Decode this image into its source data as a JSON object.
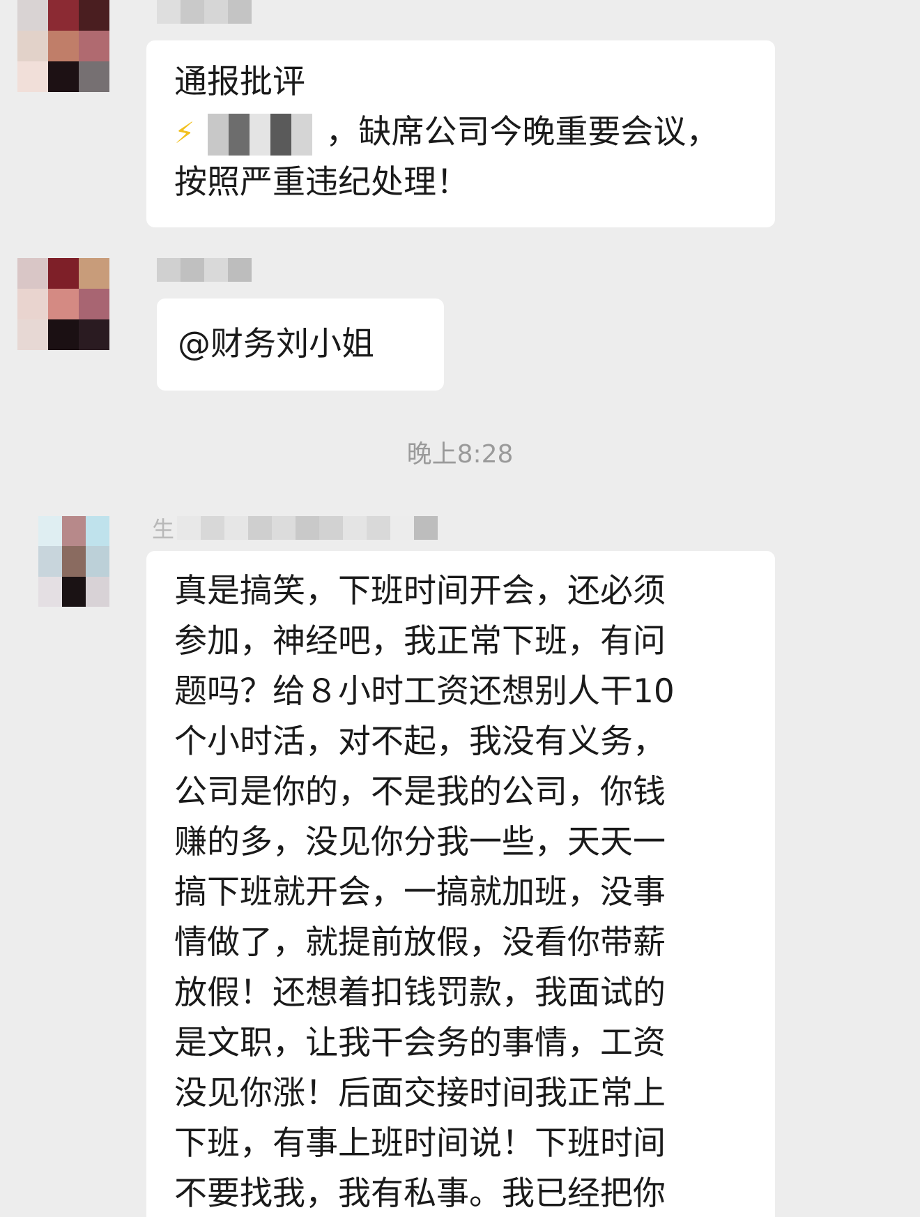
{
  "messages": [
    {
      "line1": "通报批评",
      "bolt": "⚡",
      "line2_suffix": "，缺席公司今晚重要会议，",
      "line3": "按照严重违纪处理！"
    },
    {
      "text": "@财务刘小姐"
    },
    {
      "sender_partial": "生",
      "lines": [
        "真是搞笑，下班时间开会，还必须",
        "参加，神经吧，我正常下班，有问",
        "题吗？给８小时工资还想别人干10",
        "个小时活，对不起，我没有义务，",
        "公司是你的，不是我的公司，你钱",
        "赚的多，没见你分我一些，天天一",
        "搞下班就开会，一搞就加班，没事",
        "情做了，就提前放假，没看你带薪",
        "放假！还想着扣钱罚款，我面试的",
        "是文职，让我干会务的事情，工资",
        "没见你涨！后面交接时间我正常上",
        "下班，有事上班时间说！下班时间",
        "不要找我，我有私事。我已经把你"
      ]
    }
  ],
  "timestamp": "晚上8:28",
  "colors": {
    "background": "#ededed",
    "bubble": "#ffffff",
    "text": "#1a1a1a",
    "timestamp": "#9a9a9a",
    "bolt": "#f2c01e"
  },
  "icons": {
    "bolt": "lightning-bolt-icon"
  }
}
